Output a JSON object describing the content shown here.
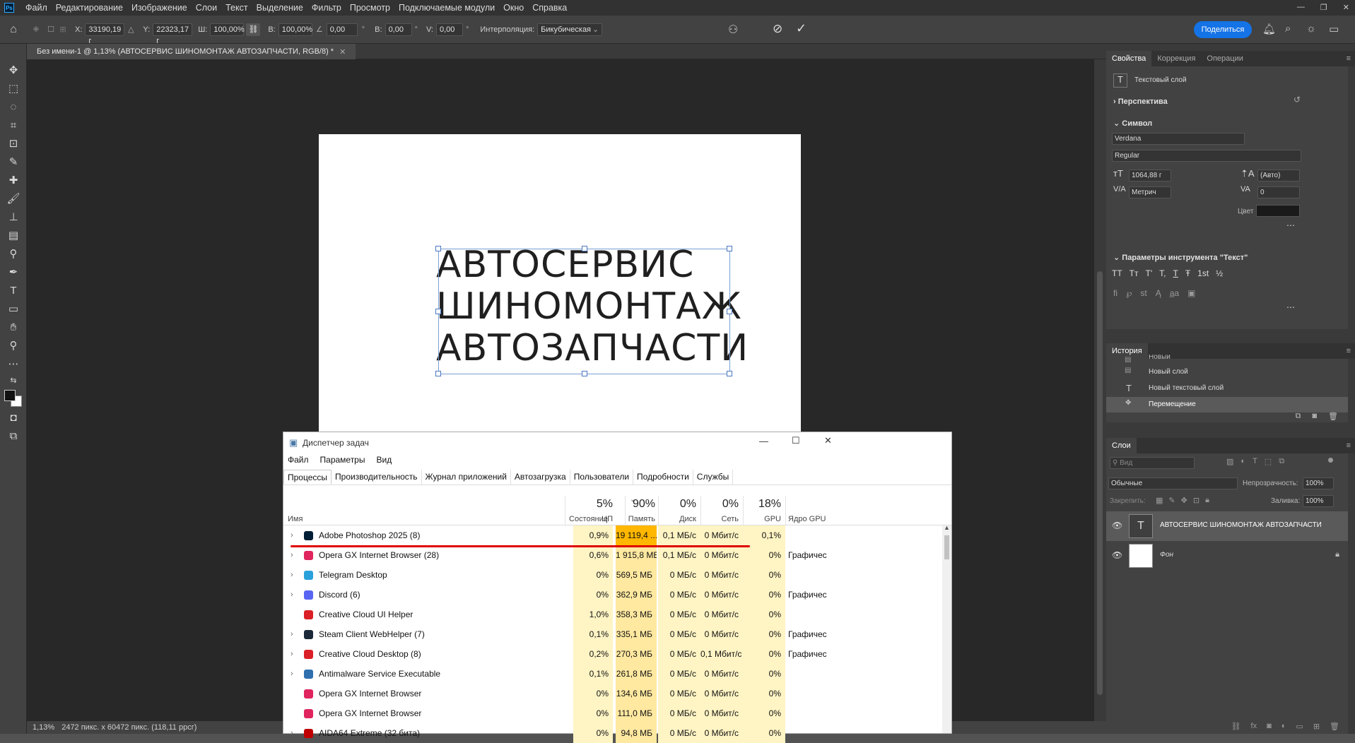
{
  "menubar": {
    "logo": "Ps",
    "items": [
      "Файл",
      "Редактирование",
      "Изображение",
      "Слои",
      "Текст",
      "Выделение",
      "Фильтр",
      "Просмотр",
      "Подключаемые модули",
      "Окно",
      "Справка"
    ]
  },
  "options": {
    "x_label": "X:",
    "x_value": "33190,19 г",
    "y_label": "Y:",
    "y_value": "22323,17 г",
    "w_label": "Ш:",
    "w_value": "100,00%",
    "h_label": "В:",
    "h_value": "100,00%",
    "angle_value": "0,00",
    "hskew_label": "В:",
    "hskew_value": "0,00",
    "vskew_label": "V:",
    "vskew_value": "0,00",
    "interp_label": "Интерполяция:",
    "interp_value": "Бикубическая",
    "share_label": "Поделиться"
  },
  "document": {
    "tab_title": "Без имени-1 @ 1,13% (АВТОСЕРВИС ШИНОМОНТАЖ АВТОЗАПЧАСТИ, RGB/8) *",
    "text_lines": [
      "АВТОСЕРВИС",
      "ШИНОМОНТАЖ",
      "АВТОЗАПЧАСТИ"
    ],
    "status_zoom": "1,13%",
    "status_info": "2472 пикс. x 60472 пикс. (118,11 ррсг)"
  },
  "properties": {
    "tabs": [
      "Свойства",
      "Коррекция",
      "Операции"
    ],
    "layer_type": "Текстовый слой",
    "perspective": "Перспектива",
    "symbol": "Символ",
    "font_family": "Verdana",
    "font_style": "Regular",
    "font_size": "1064,88 г",
    "leading": "(Авто)",
    "kerning": "Метрич",
    "tracking": "0",
    "color_label": "Цвет",
    "text_tool_params": "Параметры инструмента \"Текст\"",
    "style_buttons": [
      "TT",
      "Tт",
      "T'",
      "T,",
      "T",
      "Ŧ",
      "1st",
      "½"
    ]
  },
  "history": {
    "title": "История",
    "items": [
      "Новый",
      "Новый слой",
      "Новый текстовый слой",
      "Перемещение"
    ]
  },
  "layers": {
    "title": "Слои",
    "search_placeholder": "Вид",
    "blend_mode": "Обычные",
    "opacity_label": "Непрозрачность:",
    "opacity_value": "100%",
    "lock_label": "Закрепить:",
    "fill_label": "Заливка:",
    "fill_value": "100%",
    "items": [
      {
        "name": "АВТОСЕРВИС ШИНОМОНТАЖ АВТОЗАПЧАСТИ"
      },
      {
        "name": "Фон"
      }
    ]
  },
  "taskmgr": {
    "title": "Диспетчер задач",
    "menu": [
      "Файл",
      "Параметры",
      "Вид"
    ],
    "tabs": [
      "Процессы",
      "Производительность",
      "Журнал приложений",
      "Автозагрузка",
      "Пользователи",
      "Подробности",
      "Службы"
    ],
    "col_name": "Имя",
    "col_state": "Состояние",
    "col_cpu_pct": "5%",
    "col_cpu": "ЦП",
    "col_mem_pct": "90%",
    "col_mem": "Память",
    "col_disk_pct": "0%",
    "col_disk": "Диск",
    "col_net_pct": "0%",
    "col_net": "Сеть",
    "col_gpu_pct": "18%",
    "col_gpu": "GPU",
    "col_gpu_engine": "Ядро GPU",
    "rows": [
      {
        "name": "Adobe Photoshop 2025 (8)",
        "cpu": "0,9%",
        "mem": "19 119,4 ...",
        "disk": "0,1 МБ/с",
        "net": "0 Мбит/с",
        "gpu": "0,1%",
        "engine": "",
        "icon_color": "#001e36"
      },
      {
        "name": "Opera GX Internet Browser (28)",
        "cpu": "0,6%",
        "mem": "1 915,8 МБ",
        "disk": "0,1 МБ/с",
        "net": "0 Мбит/с",
        "gpu": "0%",
        "engine": "Графичес",
        "icon_color": "#e0245e"
      },
      {
        "name": "Telegram Desktop",
        "cpu": "0%",
        "mem": "569,5 МБ",
        "disk": "0 МБ/с",
        "net": "0 Мбит/с",
        "gpu": "0%",
        "engine": "",
        "icon_color": "#2aa1da"
      },
      {
        "name": "Discord (6)",
        "cpu": "0%",
        "mem": "362,9 МБ",
        "disk": "0 МБ/с",
        "net": "0 Мбит/с",
        "gpu": "0%",
        "engine": "Графичес",
        "icon_color": "#5865f2"
      },
      {
        "name": "Creative Cloud UI Helper",
        "cpu": "1,0%",
        "mem": "358,3 МБ",
        "disk": "0 МБ/с",
        "net": "0 Мбит/с",
        "gpu": "0%",
        "engine": "",
        "icon_color": "#da1f26"
      },
      {
        "name": "Steam Client WebHelper (7)",
        "cpu": "0,1%",
        "mem": "335,1 МБ",
        "disk": "0 МБ/с",
        "net": "0 Мбит/с",
        "gpu": "0%",
        "engine": "Графичес",
        "icon_color": "#1b2838"
      },
      {
        "name": "Creative Cloud Desktop (8)",
        "cpu": "0,2%",
        "mem": "270,3 МБ",
        "disk": "0 МБ/с",
        "net": "0,1 Мбит/с",
        "gpu": "0%",
        "engine": "Графичес",
        "icon_color": "#da1f26"
      },
      {
        "name": "Antimalware Service Executable",
        "cpu": "0,1%",
        "mem": "261,8 МБ",
        "disk": "0 МБ/с",
        "net": "0 Мбит/с",
        "gpu": "0%",
        "engine": "",
        "icon_color": "#2f6fb0"
      },
      {
        "name": "Opera GX Internet Browser",
        "cpu": "0%",
        "mem": "134,6 МБ",
        "disk": "0 МБ/с",
        "net": "0 Мбит/с",
        "gpu": "0%",
        "engine": "",
        "icon_color": "#e0245e"
      },
      {
        "name": "Opera GX Internet Browser",
        "cpu": "0%",
        "mem": "111,0 МБ",
        "disk": "0 МБ/с",
        "net": "0 Мбит/с",
        "gpu": "0%",
        "engine": "",
        "icon_color": "#e0245e"
      },
      {
        "name": "AIDA64 Extreme (32 бита)",
        "cpu": "0%",
        "mem": "94,8 МБ",
        "disk": "0 МБ/с",
        "net": "0 Мбит/с",
        "gpu": "0%",
        "engine": "",
        "icon_color": "#c00000"
      }
    ]
  },
  "colors": {
    "accent": "#1473e6",
    "mem_highlight": "#ffb700",
    "cell_light": "#fff4c4",
    "cell_mid": "#ffe8a0",
    "underline": "#e00000"
  }
}
